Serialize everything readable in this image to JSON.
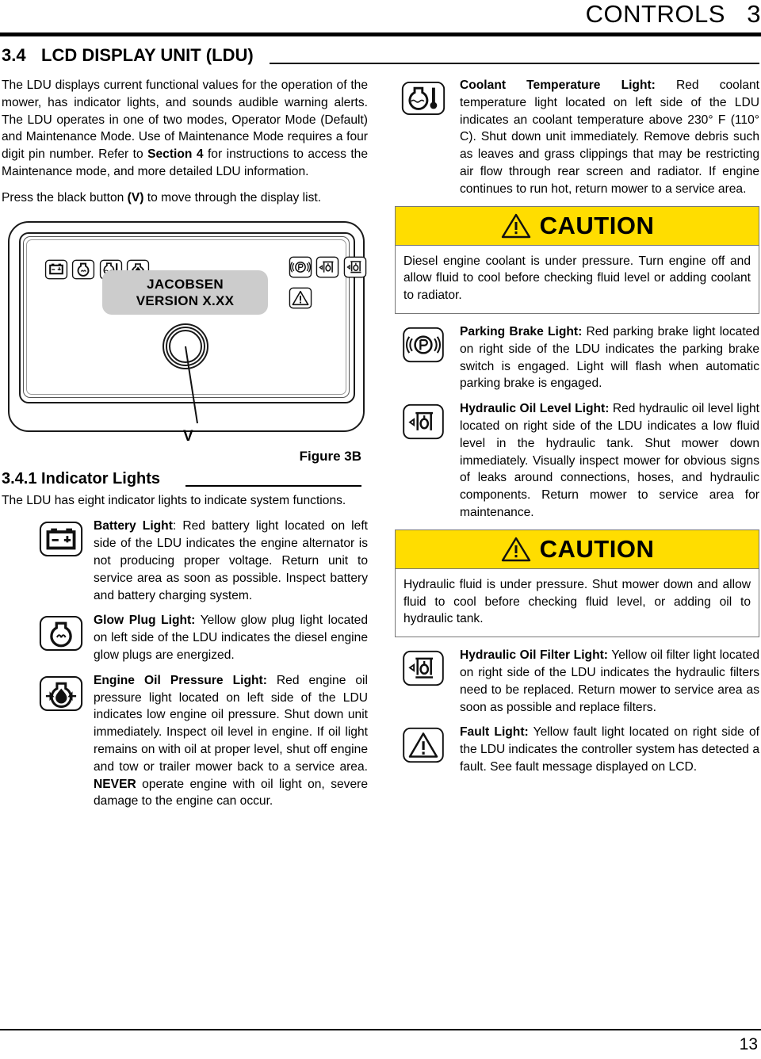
{
  "header": {
    "title": "CONTROLS",
    "chapter": "3"
  },
  "section": {
    "number": "3.4",
    "title": "LCD DISPLAY UNIT (LDU)"
  },
  "intro": {
    "p1_a": "The LDU displays current functional values for the operation of the mower, has indicator lights, and sounds audible warning alerts. The LDU operates in one of two modes, Operator Mode (Default) and Maintenance Mode. Use of Maintenance Mode requires a four digit pin number. Refer to ",
    "p1_b": "Section 4",
    "p1_c": " for instructions to access the Maintenance mode, and more detailed LDU information.",
    "p2_a": "Press the black button ",
    "p2_b": "(V)",
    "p2_c": " to move through the display list."
  },
  "figure": {
    "lcd_line1": "JACOBSEN",
    "lcd_line2": "VERSION X.XX",
    "button_label": "V",
    "caption": "Figure 3B",
    "left_icons": [
      "battery-icon",
      "glow-plug-icon",
      "coolant-temp-icon",
      "engine-oil-icon"
    ],
    "right_icons": [
      "parking-brake-icon",
      "hydraulic-oil-level-icon",
      "hydraulic-oil-filter-icon",
      "fault-icon"
    ],
    "lcd_color": "#cccccc"
  },
  "subsection": {
    "number": "3.4.1 Indicator Lights",
    "intro": "The LDU has eight indicator lights to indicate system functions."
  },
  "lights": {
    "battery": {
      "title": "Battery Light",
      "sep": ": ",
      "text": "Red battery light located on left side of the LDU indicates the engine alternator is not producing proper voltage. Return unit to service area as soon as possible. Inspect battery and battery charging system."
    },
    "glow_plug": {
      "title": "Glow Plug Light:",
      "text": " Yellow glow plug light located on left side of the LDU indicates the diesel engine glow plugs are energized."
    },
    "engine_oil": {
      "title": "Engine Oil Pressure Light:",
      "text_a": " Red engine oil pressure light located on left side of the LDU indicates low engine oil pressure. Shut down unit immediately. Inspect oil level in engine. If oil light remains on with oil at proper level, shut off engine and tow or trailer mower back to a service area. ",
      "text_b": "NEVER",
      "text_c": " operate engine with oil light on, severe damage to the engine can occur."
    },
    "coolant": {
      "title": "Coolant Temperature Light:",
      "text": " Red coolant temperature light located on left side of the LDU indicates an coolant temperature above 230° F (110° C). Shut down unit immediately. Remove debris such as leaves and grass clippings that may be restricting air flow through rear screen and radiator. If engine continues to run hot, return mower to a service area."
    },
    "parking_brake": {
      "title": "Parking Brake Light:",
      "text": " Red parking brake light located on right side of the LDU indicates the parking brake switch is engaged. Light will flash when automatic parking brake is engaged."
    },
    "hyd_level": {
      "title": "Hydraulic Oil Level Light:",
      "text": " Red hydraulic oil level light located on right side of the LDU indicates a low fluid level in the hydraulic tank. Shut mower down immediately. Visually inspect mower for obvious signs of leaks around connections, hoses, and hydraulic components. Return mower to service area for maintenance."
    },
    "hyd_filter": {
      "title": "Hydraulic Oil Filter Light:",
      "text": " Yellow oil filter light located on right side of the LDU indicates the hydraulic filters need to be replaced. Return mower to service area as soon as possible and replace filters."
    },
    "fault": {
      "title": "Fault Light:",
      "text": " Yellow fault light located on right side of the LDU indicates the controller system has detected a fault. See fault message displayed on LCD."
    }
  },
  "cautions": [
    {
      "label": "CAUTION",
      "text": "Diesel engine coolant is under pressure. Turn engine off and allow fluid to cool before checking fluid level or adding coolant to radiator."
    },
    {
      "label": "CAUTION",
      "text": "Hydraulic fluid is under pressure. Shut mower down and allow fluid to cool before checking fluid level, or adding oil to hydraulic tank."
    }
  ],
  "footer": {
    "page_number": "13"
  },
  "colors": {
    "caution_yellow": "#ffdd00",
    "lcd_gray": "#cccccc"
  }
}
